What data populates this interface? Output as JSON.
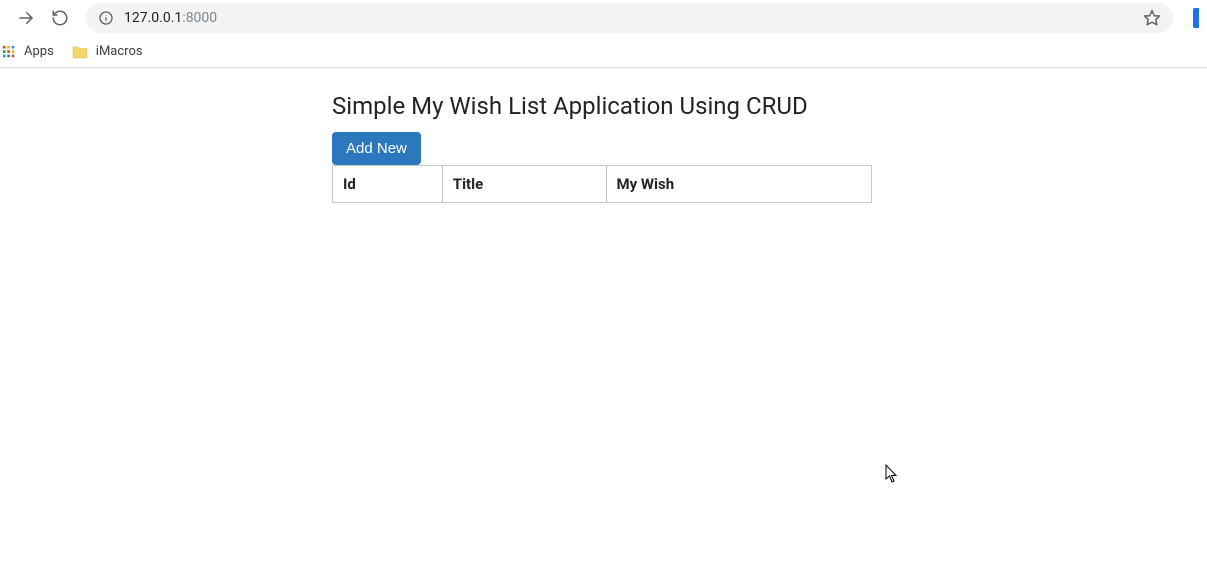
{
  "browser": {
    "url_host": "127.0.0.1",
    "url_port": ":8000",
    "bookmarks": {
      "apps_label": "Apps",
      "imacros_label": "iMacros"
    }
  },
  "page": {
    "title": "Simple My Wish List Application Using CRUD",
    "add_button_label": "Add New",
    "table": {
      "headers": {
        "id": "Id",
        "title": "Title",
        "wish": "My Wish"
      },
      "rows": []
    }
  }
}
